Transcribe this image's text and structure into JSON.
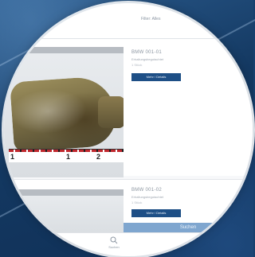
{
  "topbar": {
    "link_label": "Filter: Alles"
  },
  "items": [
    {
      "title": "BMW 001-01",
      "subtitle": "Erhaltungsbegutachtet",
      "count": "1 Stück",
      "button_label": "Mehr / Details",
      "scale_labels": [
        "1",
        "1",
        "2"
      ]
    },
    {
      "title": "BMW 001-02",
      "subtitle": "Erhaltungsbegutachtet",
      "count": "1 Stück",
      "button_label": "Mehr / Details"
    }
  ],
  "search_bar": {
    "label": "Suchen"
  },
  "bottom_nav": {
    "search_label": "Suchen",
    "icon": "search-icon"
  },
  "colors": {
    "primary": "#1e4f86",
    "search_bar": "#7fa6cf",
    "background": "#17406e"
  }
}
